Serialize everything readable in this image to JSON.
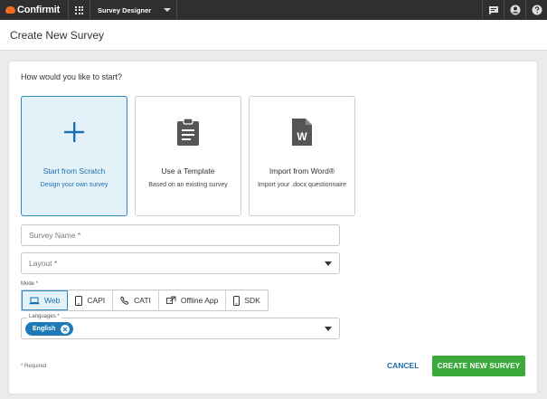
{
  "topbar": {
    "logo_text": "Confirmit",
    "product": "Survey Designer",
    "icons": [
      "apps-grid-icon",
      "chat-icon",
      "account-icon",
      "help-icon"
    ],
    "logo_color": "#f26d21"
  },
  "header": {
    "title": "Create New Survey"
  },
  "form": {
    "question": "How would you like to start?",
    "tiles": [
      {
        "title": "Start from Scratch",
        "subtitle": "Design your own survey",
        "icon": "plus-icon",
        "selected": true
      },
      {
        "title": "Use a Template",
        "subtitle": "Based on an existing survey",
        "icon": "clipboard-icon",
        "selected": false
      },
      {
        "title": "Import from Word®",
        "subtitle": "Import your .docx questionnaire",
        "icon": "word-document-icon",
        "selected": false
      }
    ],
    "survey_name": {
      "placeholder": "Survey Name *",
      "value": ""
    },
    "layout": {
      "placeholder": "Layout *",
      "value": ""
    },
    "mode_label": "Mode *",
    "modes": [
      {
        "label": "Web",
        "icon": "laptop-icon",
        "active": true
      },
      {
        "label": "CAPI",
        "icon": "tablet-icon",
        "active": false
      },
      {
        "label": "CATI",
        "icon": "phone-icon",
        "active": false
      },
      {
        "label": "Offline App",
        "icon": "offline-icon",
        "active": false
      },
      {
        "label": "SDK",
        "icon": "mobile-icon",
        "active": false
      }
    ],
    "languages_label": "Languages *",
    "languages": [
      "English"
    ],
    "required_note": "* Required",
    "cancel_label": "CANCEL",
    "create_label": "CREATE NEW SURVEY"
  },
  "colors": {
    "accent": "#1f7ab8",
    "selected_bg": "#e3f1f9",
    "create_button": "#3ca93c",
    "topbar": "#2f2f2f"
  }
}
